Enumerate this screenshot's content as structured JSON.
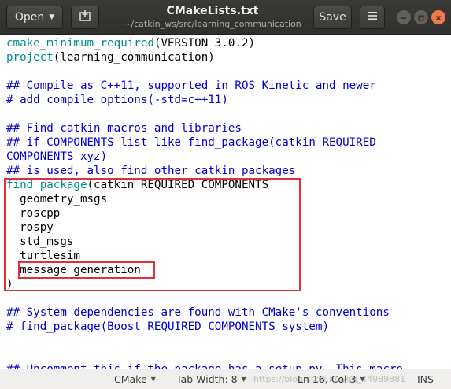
{
  "header": {
    "open_label": "Open",
    "newtab_icon": "new-tab-icon",
    "title": "CMakeLists.txt",
    "subtitle": "~/catkin_ws/src/learning_communication",
    "save_label": "Save",
    "menu_icon": "hamburger-menu-icon",
    "minimize_icon": "minimize-icon",
    "maximize_icon": "maximize-icon",
    "close_icon": "close-icon"
  },
  "editor": {
    "lines": [
      [
        {
          "t": "cmake_minimum_required",
          "c": "func"
        },
        {
          "t": "(VERSION 3.0.2)",
          "c": "plain"
        }
      ],
      [
        {
          "t": "project",
          "c": "func"
        },
        {
          "t": "(learning_communication)",
          "c": "plain"
        }
      ],
      [],
      [
        {
          "t": "## Compile as C++11, supported in ROS Kinetic and newer",
          "c": "comment"
        }
      ],
      [
        {
          "t": "# add_compile_options(-std=c++11)",
          "c": "comment"
        }
      ],
      [],
      [
        {
          "t": "## Find catkin macros and libraries",
          "c": "comment"
        }
      ],
      [
        {
          "t": "## if COMPONENTS list like find_package(catkin REQUIRED",
          "c": "comment"
        }
      ],
      [
        {
          "t": "COMPONENTS xyz)",
          "c": "comment"
        }
      ],
      [
        {
          "t": "## is used, also find other catkin packages",
          "c": "comment"
        }
      ],
      [
        {
          "t": "find_package",
          "c": "func"
        },
        {
          "t": "(catkin REQUIRED COMPONENTS",
          "c": "plain"
        }
      ],
      [
        {
          "t": "  geometry_msgs",
          "c": "plain"
        }
      ],
      [
        {
          "t": "  roscpp",
          "c": "plain"
        }
      ],
      [
        {
          "t": "  rospy",
          "c": "plain"
        }
      ],
      [
        {
          "t": "  std_msgs",
          "c": "plain"
        }
      ],
      [
        {
          "t": "  turtlesim",
          "c": "plain"
        }
      ],
      [
        {
          "t": "  message_generation",
          "c": "plain"
        }
      ],
      [
        {
          "t": ")",
          "c": "plain"
        }
      ],
      [],
      [
        {
          "t": "## System dependencies are found with CMake's conventions",
          "c": "comment"
        }
      ],
      [
        {
          "t": "# find_package(Boost REQUIRED COMPONENTS system)",
          "c": "comment"
        }
      ],
      [],
      [],
      [
        {
          "t": "## Uncomment this if the package has a setup.py. This macro",
          "c": "comment"
        }
      ]
    ]
  },
  "statusbar": {
    "language": "CMake",
    "tab_width": "Tab Width: 8",
    "position": "Ln 16, Col 3",
    "mode": "INS",
    "watermark": "https://blog.csdn.net/qq_44989881"
  },
  "colors": {
    "function": "#008a8c",
    "comment": "#0000c8",
    "highlight_box": "#e0303b",
    "close_button": "#ef7a4b"
  }
}
